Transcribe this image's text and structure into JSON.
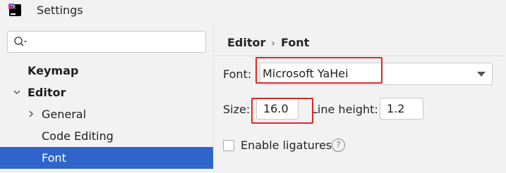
{
  "window": {
    "title": "Settings",
    "app_icon": "intellij-idea-logo",
    "app_icon_text": "IE"
  },
  "sidebar": {
    "search": {
      "placeholder": "",
      "icon": "search-icon"
    },
    "items": [
      {
        "label": "Keymap",
        "bold": true,
        "expandable": false,
        "selected": false
      },
      {
        "label": "Editor",
        "bold": true,
        "expandable": true,
        "expanded": true,
        "selected": false
      },
      {
        "label": "General",
        "bold": false,
        "expandable": true,
        "expanded": false,
        "selected": false
      },
      {
        "label": "Code Editing",
        "bold": false,
        "expandable": false,
        "selected": false
      },
      {
        "label": "Font",
        "bold": false,
        "expandable": false,
        "selected": true
      }
    ]
  },
  "content": {
    "breadcrumb": {
      "parent": "Editor",
      "separator": "›",
      "current": "Font"
    },
    "font": {
      "label": "Font:",
      "value": "Microsoft YaHei"
    },
    "size": {
      "label": "Size:",
      "value": "16.0"
    },
    "line_height": {
      "label": "Line height:",
      "value": "1.2"
    },
    "ligatures": {
      "label": "Enable ligatures",
      "checked": false,
      "help_icon": "?"
    }
  },
  "colors": {
    "selection": "#2f65ca",
    "highlight": "#e32626",
    "background": "#f2f2f2"
  }
}
